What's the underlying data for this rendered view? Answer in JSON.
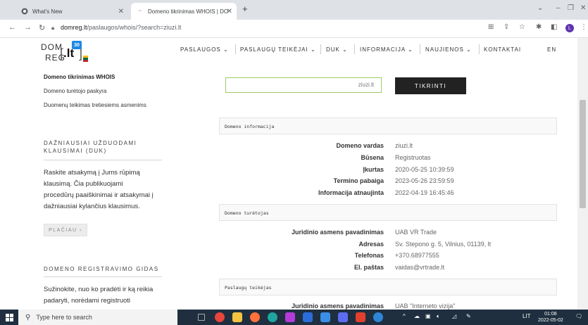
{
  "browser": {
    "tabs": [
      {
        "title": "What's New",
        "active": false
      },
      {
        "title": "Domeno tikrinimas WHOIS | DO",
        "active": true
      }
    ],
    "new_tab": "+",
    "url_host": "domreg.lt",
    "url_path": "/paslaugos/whois/?search=ziuzi.lt",
    "profile_initial": "L"
  },
  "header": {
    "logo": {
      "dom": "DOM",
      "reg": "REG",
      "lt": ".lt",
      "badge": "30"
    },
    "nav": [
      {
        "label": "PASLAUGOS ⌄"
      },
      {
        "label": "PASLAUGŲ TEIKĖJAI ⌄"
      },
      {
        "label": "DUK ⌄"
      },
      {
        "label": "INFORMACIJA ⌄"
      },
      {
        "label": "NAUJIENOS ⌄"
      },
      {
        "label": "KONTAKTAI"
      },
      {
        "label": "EN"
      }
    ]
  },
  "sidebar": {
    "links": [
      {
        "label": "Domeno tikrinimas WHOIS",
        "active": true
      },
      {
        "label": "Domeno turėtojo paskyra",
        "active": false
      },
      {
        "label": "Duomenų teikimas tretiesiems asmenims",
        "active": false
      }
    ],
    "faq": {
      "heading_l1": "DAŽNIAUSIAI UŽDUODAMI",
      "heading_l2": "KLAUSIMAI (DUK)",
      "text_lines": [
        "Raskite atsakymą į Jums rūpimą",
        "klausimą. Čia publikuojami",
        "procedūrų paaiškinimai ir atsakymai į",
        "dažniausiai kylančius klausimus."
      ],
      "more": "PLAČIAU ›"
    },
    "guide": {
      "heading": "DOMENO REGISTRAVIMO GIDAS",
      "text_lines": [
        "Sužinokite, nuo ko pradėti ir ką reikia",
        "padaryti, norėdami registruoti"
      ]
    }
  },
  "search": {
    "value": "ziuzi.lt",
    "button": "TIKRINTI"
  },
  "sections": {
    "domain_info": {
      "title": "Domeno informacija",
      "rows": [
        {
          "label": "Domeno vardas",
          "value": "ziuzi.lt"
        },
        {
          "label": "Būsena",
          "value": "Registruotas"
        },
        {
          "label": "Įkurtas",
          "value": "2020-05-25 10:39:59"
        },
        {
          "label": "Termino pabaiga",
          "value": "2023-05-26 23:59:59"
        },
        {
          "label": "Informacija atnaujinta",
          "value": "2022-04-19 16:45:46"
        }
      ]
    },
    "holder": {
      "title": "Domeno turėtojas",
      "rows": [
        {
          "label": "Juridinio asmens pavadinimas",
          "value": "UAB VR Trade"
        },
        {
          "label": "Adresas",
          "value": "Sv. Stepono g. 5, Vilnius, 01139, lt"
        },
        {
          "label": "Telefonas",
          "value": "+370.68977555"
        },
        {
          "label": "El. paštas",
          "value": "vaidas@vrtrade.lt"
        }
      ]
    },
    "provider": {
      "title": "Paslaugų teikėjas",
      "rows": [
        {
          "label": "Juridinio asmens pavadinimas",
          "value": "UAB \"Interneto vizija\""
        }
      ]
    }
  },
  "taskbar": {
    "search_placeholder": "Type here to search",
    "lang": "LIT",
    "time": "01:08",
    "date": "2022-05-02"
  }
}
